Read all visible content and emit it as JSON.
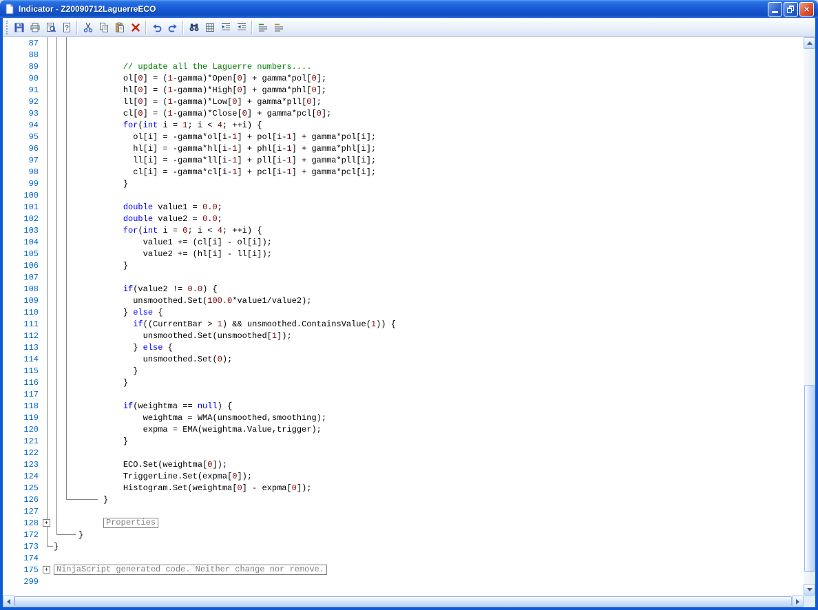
{
  "window": {
    "title": "Indicator - Z20090712LaguerreECO",
    "controls": [
      {
        "name": "minimize"
      },
      {
        "name": "restore"
      },
      {
        "name": "close",
        "glyph": "×"
      }
    ]
  },
  "toolbar": {
    "buttons": [
      {
        "name": "save"
      },
      {
        "name": "print"
      },
      {
        "name": "print-preview"
      },
      {
        "name": "help"
      },
      {
        "name": "cut"
      },
      {
        "name": "copy"
      },
      {
        "name": "paste"
      },
      {
        "name": "delete"
      },
      {
        "name": "undo"
      },
      {
        "name": "redo"
      },
      {
        "name": "find"
      },
      {
        "name": "replace"
      },
      {
        "name": "indent"
      },
      {
        "name": "outdent"
      },
      {
        "name": "comment"
      },
      {
        "name": "uncomment"
      }
    ]
  },
  "editor": {
    "colors": {
      "keyword": "#0000ff",
      "comment": "#008000",
      "number": "#800000",
      "plain": "#000000",
      "line_number": "#0066cc",
      "collapsed": "#808080"
    },
    "keywords": [
      "for",
      "int",
      "double",
      "if",
      "else",
      "null"
    ],
    "fold_glyph": "+",
    "lines": [
      {
        "num": "87",
        "text": ""
      },
      {
        "num": "88",
        "text": ""
      },
      {
        "num": "89",
        "text": "              // update all the Laguerre numbers...."
      },
      {
        "num": "90",
        "text": "              ol[0] = (1-gamma)*Open[0] + gamma*pol[0];"
      },
      {
        "num": "91",
        "text": "              hl[0] = (1-gamma)*High[0] + gamma*phl[0];"
      },
      {
        "num": "92",
        "text": "              ll[0] = (1-gamma)*Low[0] + gamma*pll[0];"
      },
      {
        "num": "93",
        "text": "              cl[0] = (1-gamma)*Close[0] + gamma*pcl[0];"
      },
      {
        "num": "94",
        "text": "              for(int i = 1; i < 4; ++i) {"
      },
      {
        "num": "95",
        "text": "                ol[i] = -gamma*ol[i-1] + pol[i-1] + gamma*pol[i];"
      },
      {
        "num": "96",
        "text": "                hl[i] = -gamma*hl[i-1] + phl[i-1] + gamma*phl[i];"
      },
      {
        "num": "97",
        "text": "                ll[i] = -gamma*ll[i-1] + pll[i-1] + gamma*pll[i];"
      },
      {
        "num": "98",
        "text": "                cl[i] = -gamma*cl[i-1] + pcl[i-1] + gamma*pcl[i];"
      },
      {
        "num": "99",
        "text": "              }"
      },
      {
        "num": "100",
        "text": ""
      },
      {
        "num": "101",
        "text": "              double value1 = 0.0;"
      },
      {
        "num": "102",
        "text": "              double value2 = 0.0;"
      },
      {
        "num": "103",
        "text": "              for(int i = 0; i < 4; ++i) {"
      },
      {
        "num": "104",
        "text": "                  value1 += (cl[i] - ol[i]);"
      },
      {
        "num": "105",
        "text": "                  value2 += (hl[i] - ll[i]);"
      },
      {
        "num": "106",
        "text": "              }"
      },
      {
        "num": "107",
        "text": ""
      },
      {
        "num": "108",
        "text": "              if(value2 != 0.0) {"
      },
      {
        "num": "109",
        "text": "                unsmoothed.Set(100.0*value1/value2);"
      },
      {
        "num": "110",
        "text": "              } else {"
      },
      {
        "num": "111",
        "text": "                if((CurrentBar > 1) && unsmoothed.ContainsValue(1)) {"
      },
      {
        "num": "112",
        "text": "                  unsmoothed.Set(unsmoothed[1]);"
      },
      {
        "num": "113",
        "text": "                } else {"
      },
      {
        "num": "114",
        "text": "                  unsmoothed.Set(0);"
      },
      {
        "num": "115",
        "text": "                }"
      },
      {
        "num": "116",
        "text": "              }"
      },
      {
        "num": "117",
        "text": ""
      },
      {
        "num": "118",
        "text": "              if(weightma == null) {"
      },
      {
        "num": "119",
        "text": "                  weightma = WMA(unsmoothed,smoothing);"
      },
      {
        "num": "120",
        "text": "                  expma = EMA(weightma.Value,trigger);"
      },
      {
        "num": "121",
        "text": "              }"
      },
      {
        "num": "122",
        "text": ""
      },
      {
        "num": "123",
        "text": "              ECO.Set(weightma[0]);"
      },
      {
        "num": "124",
        "text": "              TriggerLine.Set(expma[0]);"
      },
      {
        "num": "125",
        "text": "              Histogram.Set(weightma[0] - expma[0]);"
      },
      {
        "num": "126",
        "text": "          }"
      },
      {
        "num": "127",
        "text": ""
      },
      {
        "num": "128",
        "fold": true,
        "indent": 10,
        "collapsed": "Properties"
      },
      {
        "num": "172",
        "text": "     }"
      },
      {
        "num": "173",
        "text": "}"
      },
      {
        "num": "174",
        "text": ""
      },
      {
        "num": "175",
        "fold": true,
        "indent": 0,
        "collapsed": "NinjaScript generated code. Neither change nor remove."
      },
      {
        "num": "299",
        "text": ""
      }
    ]
  }
}
